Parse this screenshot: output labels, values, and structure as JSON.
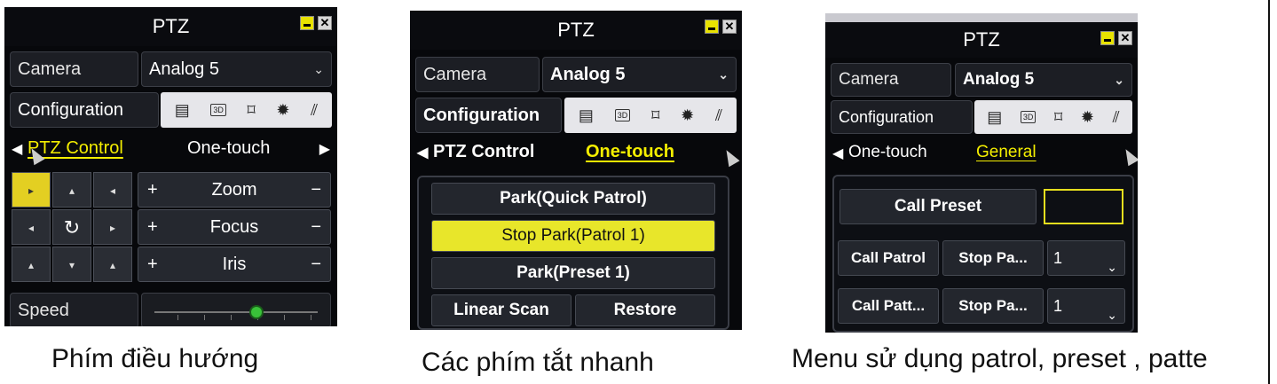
{
  "panel1": {
    "title": "PTZ",
    "camera_label": "Camera",
    "camera_value": "Analog 5",
    "config_label": "Configuration",
    "tab_left": "PTZ Control",
    "tab_right": "One-touch",
    "zoom_label": "Zoom",
    "focus_label": "Focus",
    "iris_label": "Iris",
    "plus": "+",
    "minus": "−",
    "speed_label": "Speed",
    "speed_level": 0.62,
    "caption": "Phím điều hướng"
  },
  "panel2": {
    "title": "PTZ",
    "camera_label": "Camera",
    "camera_value": "Analog 5",
    "config_label": "Configuration",
    "tab_left": "PTZ Control",
    "tab_right": "One-touch",
    "btn_park_quick": "Park(Quick Patrol)",
    "btn_stop_park": "Stop Park(Patrol 1)",
    "btn_park_preset": "Park(Preset 1)",
    "btn_linear_scan": "Linear Scan",
    "btn_restore": "Restore",
    "caption": "Các phím tắt nhanh"
  },
  "panel3": {
    "title": "PTZ",
    "camera_label": "Camera",
    "camera_value": "Analog 5",
    "config_label": "Configuration",
    "tab_left": "One-touch",
    "tab_right": "General",
    "btn_call_preset": "Call Preset",
    "btn_call_patrol": "Call Patrol",
    "btn_stop_patrol": "Stop Pa...",
    "patrol_value": "1",
    "btn_call_pattern": "Call Patt...",
    "btn_stop_pattern": "Stop Pa...",
    "pattern_value": "1",
    "caption": "Menu sử dụng patrol, preset , patte"
  },
  "colors": {
    "accent_yellow": "#e8e62a",
    "panel_bg": "#0d0f14",
    "tab_active": "#f4ee00"
  }
}
